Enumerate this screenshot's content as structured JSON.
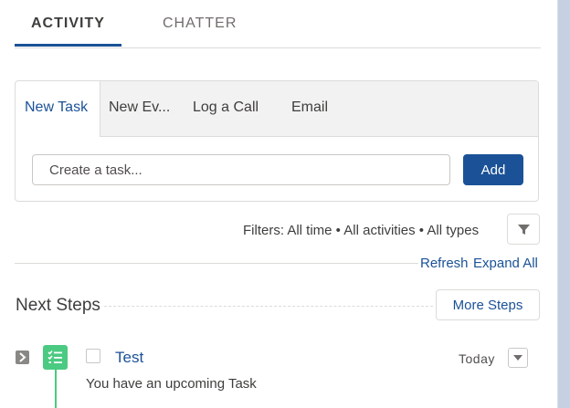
{
  "tabs": {
    "activity": "ACTIVITY",
    "chatter": "CHATTER"
  },
  "publisher": {
    "tabs": [
      "New Task",
      "New Ev...",
      "Log a Call",
      "Email"
    ],
    "input_placeholder": "Create a task...",
    "add_label": "Add"
  },
  "filters": {
    "text": "Filters: All time • All activities • All types",
    "refresh": "Refresh",
    "expand_all": "Expand All"
  },
  "next_steps": {
    "title": "Next Steps",
    "more_steps": "More Steps"
  },
  "task": {
    "title": "Test",
    "date": "Today",
    "description": "You have an upcoming Task"
  },
  "colors": {
    "brand": "#1b5297",
    "task_green": "#4bca81",
    "border": "#dddbda"
  },
  "icons": {
    "filter": "funnel-icon",
    "task": "task-checklist-icon",
    "expand": "chevron-right-icon",
    "menu": "chevron-down-icon"
  }
}
